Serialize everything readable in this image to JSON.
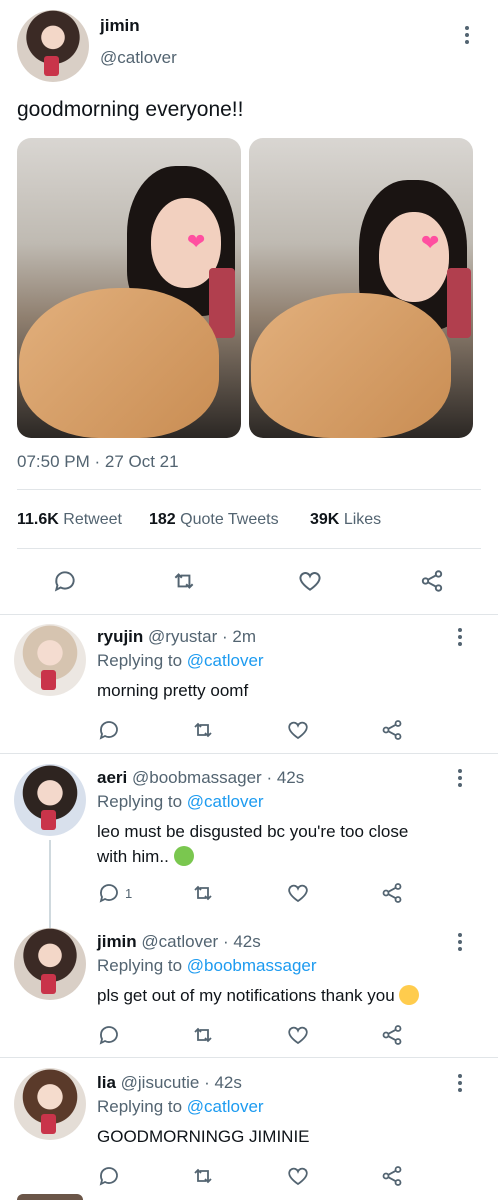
{
  "main_tweet": {
    "name": "jimin",
    "handle": "@catlover",
    "text": "goodmorning everyone!!",
    "time": "07:50 PM · 27 Oct 21",
    "stats": {
      "retweets_count": "11.6K",
      "retweets_label": "Retweet",
      "quotes_count": "182",
      "quotes_label": "Quote Tweets",
      "likes_count": "39K",
      "likes_label": "Likes"
    },
    "icons": [
      "reply-icon",
      "retweet-icon",
      "like-icon",
      "share-icon"
    ]
  },
  "replies": [
    {
      "name": "ryujin",
      "handle": "@ryustar",
      "time": "· 2m",
      "replying_prefix": "Replying to",
      "replying_to": "@catlover",
      "text": "morning pretty oomf",
      "reply_count": ""
    },
    {
      "name": "aeri",
      "handle": "@boobmassager",
      "time": "· 42s",
      "replying_prefix": "Replying to",
      "replying_to": "@catlover",
      "text_line1": "leo must be disgusted bc you're too close",
      "text_line2": "with him..",
      "emoji": "nauseated-face-emoji",
      "reply_count": "1"
    },
    {
      "name": "jimin",
      "handle": "@catlover",
      "time": "· 42s",
      "replying_prefix": "Replying to",
      "replying_to": "@boobmassager",
      "text": "pls get out of my notifications thank you",
      "emoji": "smiling-face-emoji",
      "reply_count": ""
    },
    {
      "name": "lia",
      "handle": "@jisucutie",
      "time": "· 42s",
      "replying_prefix": "Replying to",
      "replying_to": "@catlover",
      "text": "GOODMORNINGG JIMINIE",
      "reply_count": ""
    }
  ],
  "colors": {
    "link": "#1d9bf0",
    "secondary_text": "#536471",
    "divider": "#e1e5e8"
  }
}
